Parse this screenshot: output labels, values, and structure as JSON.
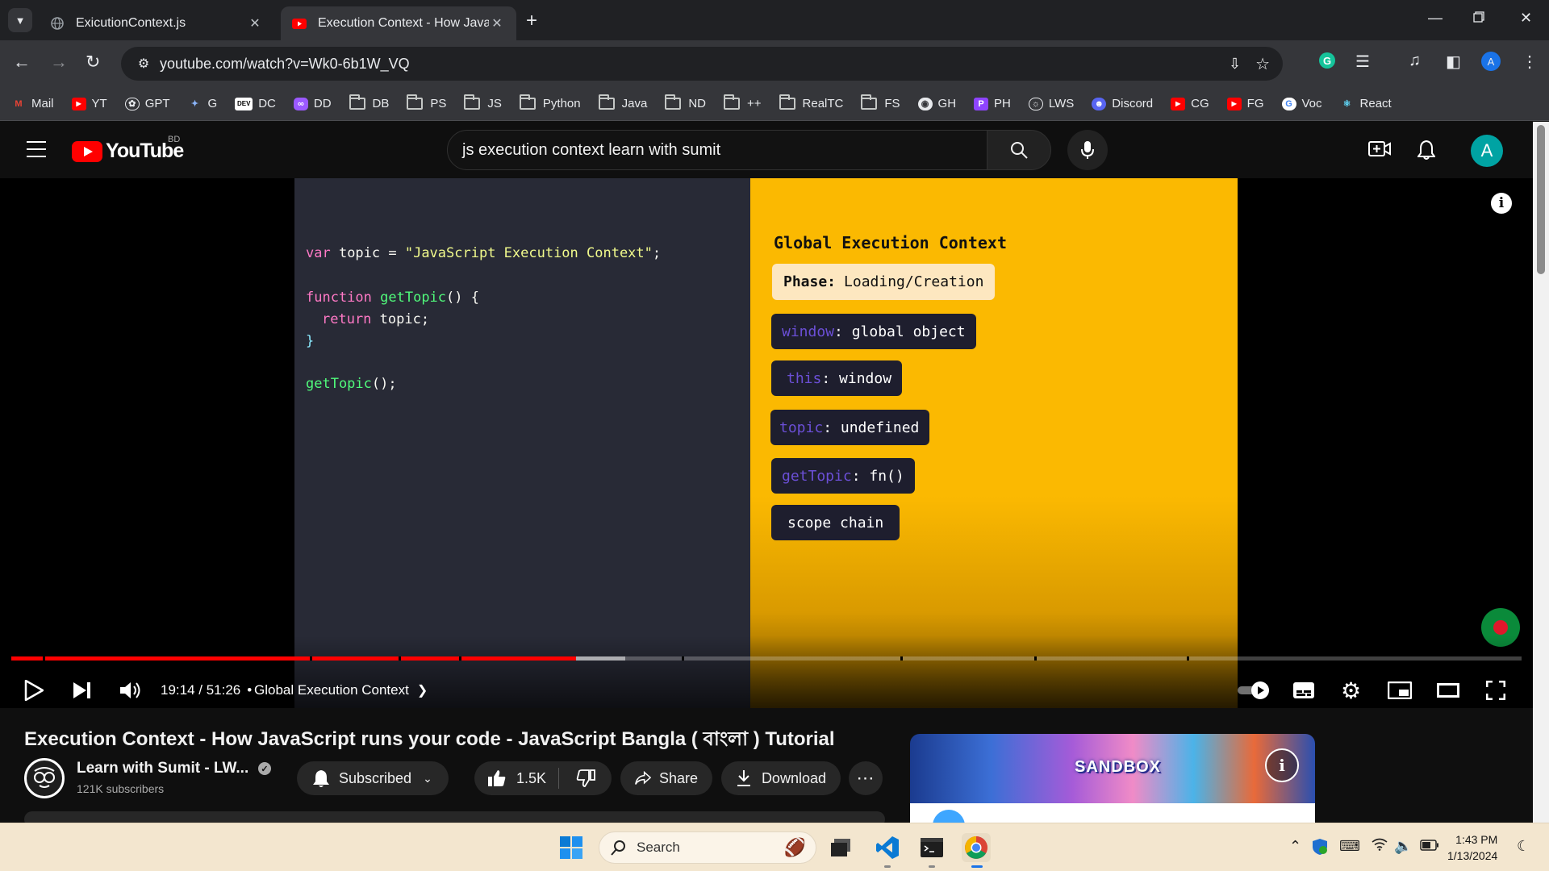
{
  "browser": {
    "tabs": [
      {
        "title": "ExicutionContext.js",
        "active": false
      },
      {
        "title": "Execution Context - How JavaSc",
        "active": true
      }
    ],
    "url": "youtube.com/watch?v=Wk0-6b1W_VQ",
    "bookmarks": [
      "Mail",
      "YT",
      "GPT",
      "G",
      "DC",
      "DD",
      "DB",
      "PS",
      "JS",
      "Python",
      "Java",
      "ND",
      "++",
      "RealTC",
      "FS",
      "GH",
      "PH",
      "LWS",
      "Discord",
      "CG",
      "FG",
      "Voc",
      "React"
    ],
    "profile_initial": "A"
  },
  "youtube": {
    "logo_text": "YouTube",
    "country_code": "BD",
    "search_query": "js execution context learn with sumit",
    "avatar_initial": "A"
  },
  "video": {
    "code": {
      "line1": {
        "kw": "var",
        "rest": " topic = ",
        "str": "\"JavaScript Execution Context\"",
        "end": ";"
      },
      "line2": {
        "kw": "function",
        "fn": "getTopic",
        "rest": "() {"
      },
      "line3": {
        "kw": "return",
        "rest": " topic;"
      },
      "line4": "}",
      "line5": {
        "fn": "getTopic",
        "rest": "();"
      }
    },
    "context_title": "Global Execution Context",
    "phase_label": "Phase:",
    "phase_value": "Loading/Creation",
    "entries": [
      {
        "prop": "window",
        "value": ": global object"
      },
      {
        "prop": "this",
        "value": ": window"
      },
      {
        "prop": "topic",
        "value": ": undefined"
      },
      {
        "prop": "getTopic",
        "value": ": fn()"
      },
      {
        "prop": "",
        "value": "scope chain"
      }
    ],
    "time_display": "19:14 / 51:26",
    "chapter": "Global Execution Context",
    "progress_played": 0.3737,
    "progress_buffered": 0.4066,
    "accent": "#ff0000"
  },
  "info": {
    "title": "Execution Context - How JavaScript runs your code - JavaScript Bangla ( বাংলা ) Tutorial",
    "channel_name": "Learn with Sumit - LW...",
    "subscribers": "121K subscribers",
    "subscribed_label": "Subscribed",
    "likes": "1.5K",
    "share_label": "Share",
    "download_label": "Download",
    "ad_brand": "SANDBOX"
  },
  "taskbar": {
    "search_placeholder": "Search",
    "time": "1:43 PM",
    "date": "1/13/2024"
  }
}
